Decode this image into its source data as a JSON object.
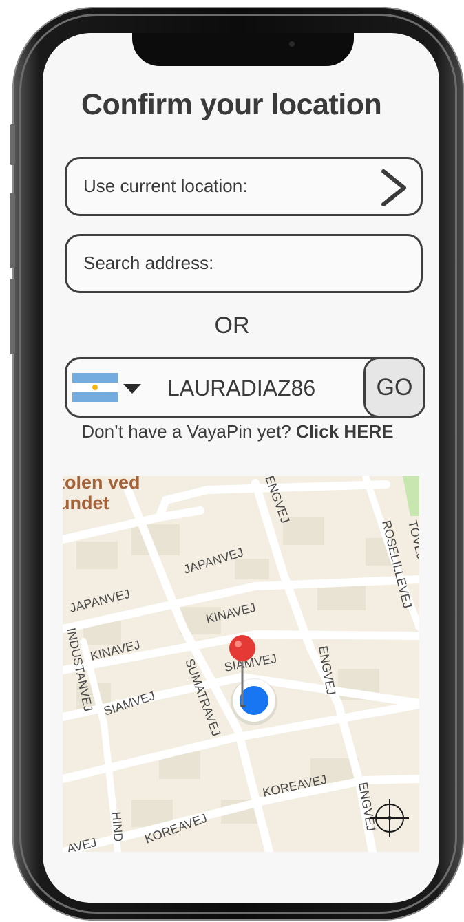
{
  "title": "Confirm your location",
  "current_location": {
    "label": "Use current location:"
  },
  "search": {
    "label": "Search address:"
  },
  "separator": "OR",
  "vayapin": {
    "value": "LAURADIAZ86",
    "go_label": "GO",
    "country_flag": "argentina-flag-icon"
  },
  "signup_hint": {
    "text": "Don’t have a VayaPin yet?",
    "link": "Click HERE"
  },
  "map": {
    "place_label_line1": "tolen ved",
    "place_label_line2": "undet",
    "streets": {
      "japanvej_1": "JAPANVEJ",
      "japanvej_2": "JAPANVEJ",
      "kinavej_1": "KINAVEJ",
      "kinavej_2": "KINAVEJ",
      "siamvej_1": "SIAMVEJ",
      "siamvej_2": "SIAMVEJ",
      "sumatravej": "SUMATRAVEJ",
      "industanvej": "INDUSTANVEJ",
      "koreavej_1": "KOREAVEJ",
      "koreavej_2": "KOREAVEJ",
      "engvej_1": "ENGVEJ",
      "engvej_2": "ENGVEJ",
      "engvej_3": "ENGVEJ",
      "rosellillevej": "ROSELILLEVEJ",
      "tovej": "TOVEJ",
      "hind": "HIND",
      "avej": "AVEJ"
    }
  },
  "colors": {
    "text": "#3a3a3a",
    "pin_red": "#e53935",
    "location_blue": "#1976f2",
    "flag_blue": "#74acdf",
    "flag_sun": "#f6b40e"
  }
}
